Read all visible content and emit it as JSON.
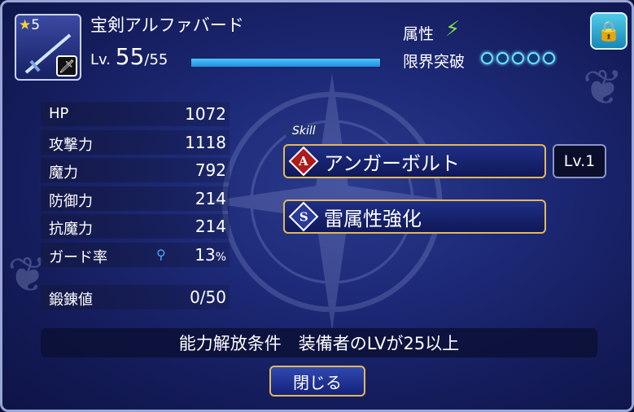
{
  "weapon": {
    "rarity": "5",
    "name": "宝剣アルファバード",
    "level_prefix": "Lv.",
    "level_current": "55",
    "level_max": "/55",
    "xp_fraction": 1.0,
    "icon": "sword-icon"
  },
  "header": {
    "attribute_label": "属性",
    "attribute_icon": "lightning-icon",
    "limit_break_label": "限界突破",
    "limit_break_count": 5,
    "lock_icon": "lock-icon"
  },
  "stats": [
    {
      "name": "HP",
      "value": "1072"
    },
    {
      "name": "攻撃力",
      "value": "1118"
    },
    {
      "name": "魔力",
      "value": "792"
    },
    {
      "name": "防御力",
      "value": "214"
    },
    {
      "name": "抗魔力",
      "value": "214"
    },
    {
      "name": "ガード率",
      "value": "13",
      "unit": "%"
    }
  ],
  "forge": {
    "name": "鍛錬値",
    "value": "0/50"
  },
  "skills": {
    "tag": "Skill",
    "items": [
      {
        "badge": "A",
        "name": "アンガーボルト",
        "badge_color": "#b01a1a"
      },
      {
        "badge": "S",
        "name": "雷属性強化",
        "badge_color": "#2a3a9a"
      }
    ],
    "level_label": "Lv.1"
  },
  "condition": "能力解放条件　装備者のLVが25以上",
  "close_label": "閉じる",
  "colors": {
    "accent_gold": "#e2b85a",
    "xp_blue": "#4fc3ff",
    "panel_navy": "#1d2a78"
  }
}
